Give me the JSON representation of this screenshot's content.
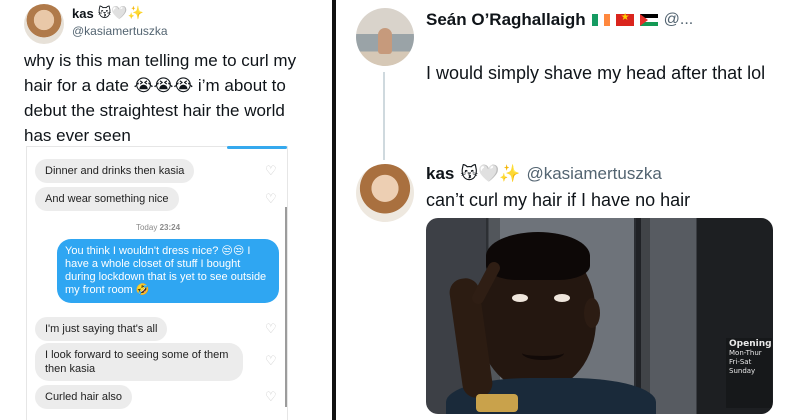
{
  "left_tweet": {
    "name": "kas",
    "name_emoji": "😽🤍✨",
    "handle": "@kasiamertuszka",
    "text": "why is this man telling me to curl my hair for a date 😭😭😭 i’m about to debut the straightest hair the world has ever seen"
  },
  "chat": {
    "messages": [
      {
        "text": "Dinner and drinks then kasia"
      },
      {
        "text": "And wear something nice"
      }
    ],
    "time_day": "Today",
    "time_value": "23:24",
    "sent": "You think I wouldn't dress nice? 😒😒 I have a whole closet of stuff I bought during lockdown that is yet to see outside my front room 🤣",
    "later": [
      {
        "text": "I'm just saying that's all"
      },
      {
        "text": "I look forward to seeing some of them then kasia"
      },
      {
        "text": "Curled hair also"
      }
    ],
    "heart_glyph": "♡"
  },
  "reply_sean": {
    "name": "Seán O’Raghallaigh",
    "handle": "@...",
    "text": "I would simply shave my head after that lol"
  },
  "reply_kas": {
    "name": "kas",
    "name_emoji": "😽🤍✨",
    "handle": "@kasiamertuszka",
    "text": "can’t curl my hair if I have no hair"
  },
  "meme_sign": {
    "line1": "Opening",
    "line2": "Mon-Thur",
    "line3": "Fri-Sat",
    "line4": "Sunday"
  },
  "colors": {
    "sent_bubble": "#2fa6f2",
    "received_bubble": "#ececec",
    "divider": "#111111",
    "handle": "#536471"
  }
}
